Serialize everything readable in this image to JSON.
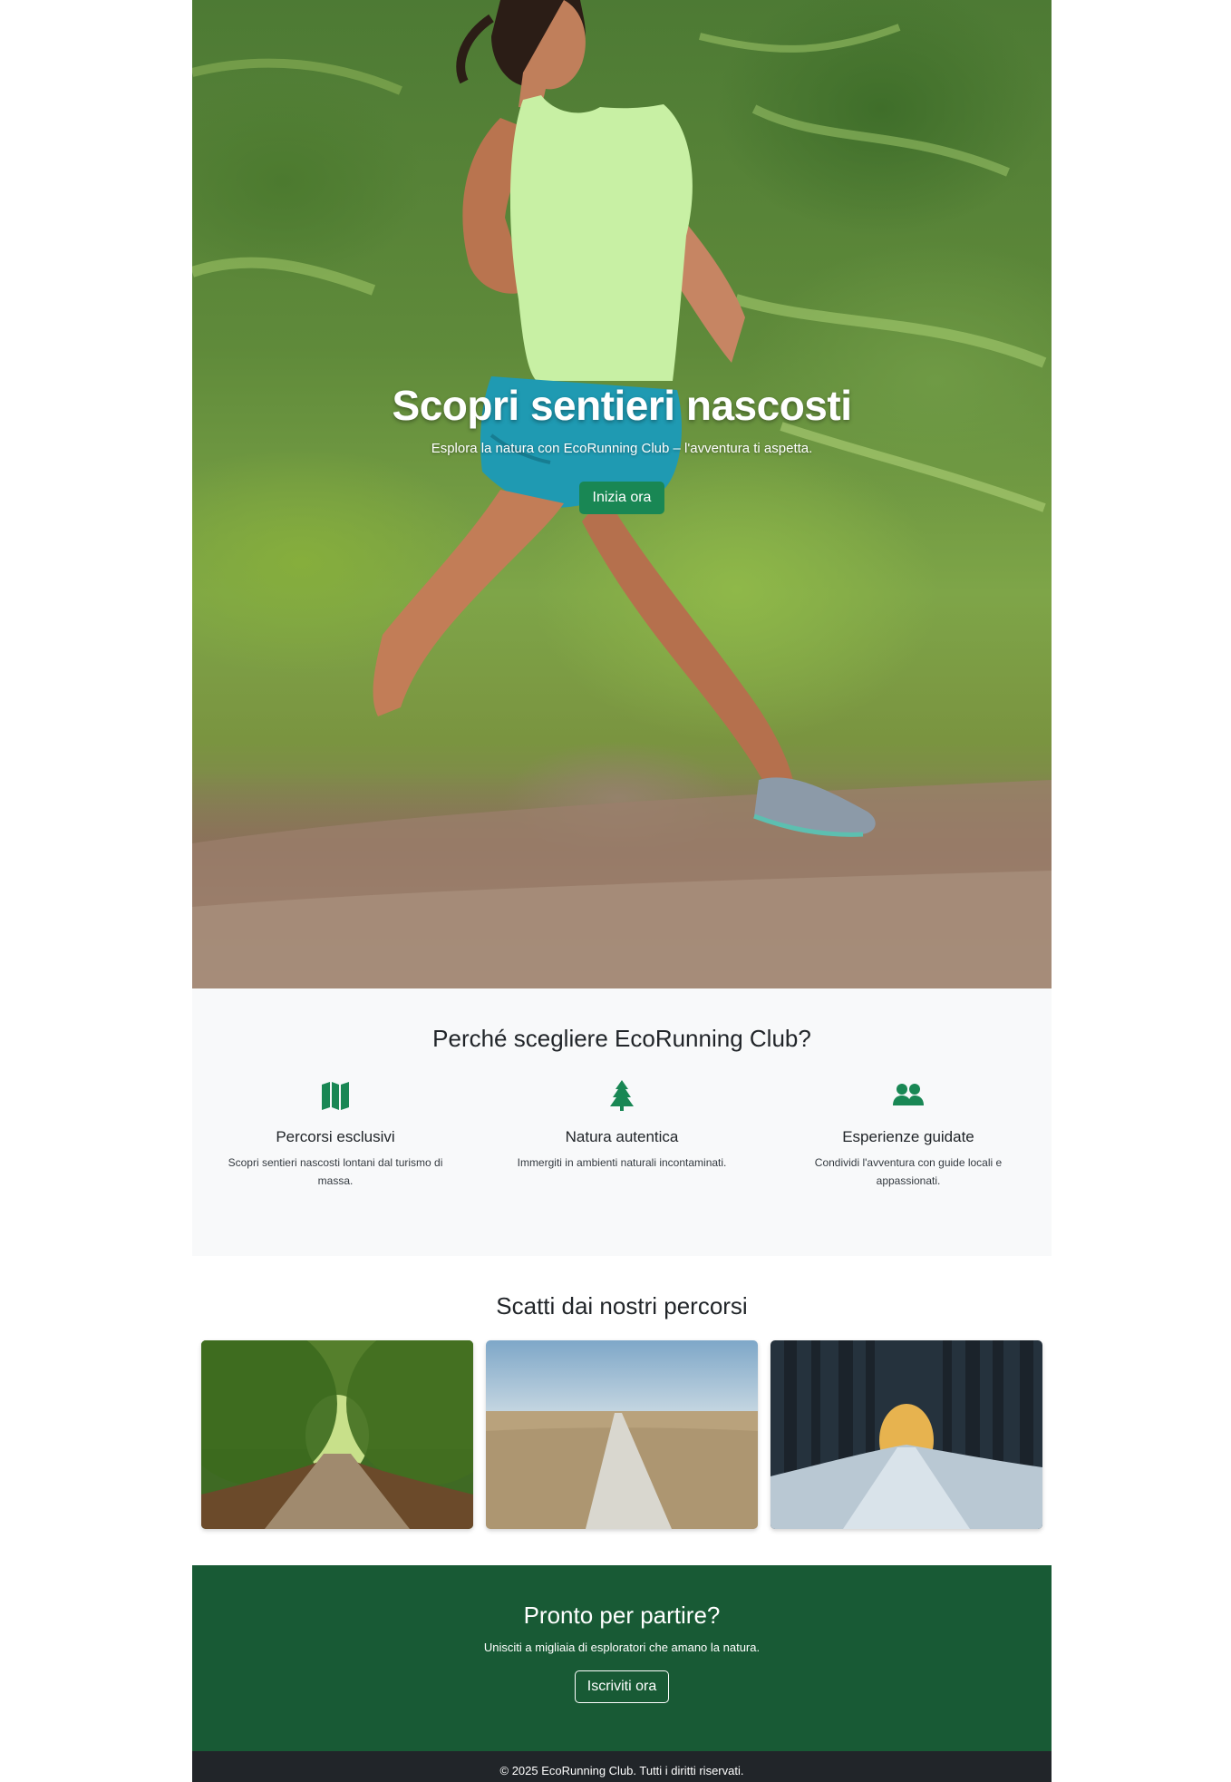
{
  "hero": {
    "title": "Scopri sentieri nascosti",
    "subtitle": "Esplora la natura con EcoRunning Club – l'avventura ti aspetta.",
    "cta_label": "Inizia ora"
  },
  "features": {
    "title": "Perché scegliere EcoRunning Club?",
    "items": [
      {
        "icon": "map-icon",
        "title": "Percorsi esclusivi",
        "text": "Scopri sentieri nascosti lontani dal turismo di massa."
      },
      {
        "icon": "tree-icon",
        "title": "Natura autentica",
        "text": "Immergiti in ambienti naturali incontaminati."
      },
      {
        "icon": "people-icon",
        "title": "Esperienze guidate",
        "text": "Condividi l'avventura con guide locali e appassionati."
      }
    ]
  },
  "gallery": {
    "title": "Scatti dai nostri percorsi"
  },
  "cta": {
    "title": "Pronto per partire?",
    "text": "Unisciti a migliaia di esploratori che amano la natura.",
    "button_label": "Iscriviti ora"
  },
  "footer": {
    "copyright": "© 2025 EcoRunning Club. Tutti i diritti riservati."
  },
  "colors": {
    "accent": "#198754",
    "cta_background": "#185a35",
    "footer_background": "#212529",
    "section_background": "#f8f9fa"
  }
}
